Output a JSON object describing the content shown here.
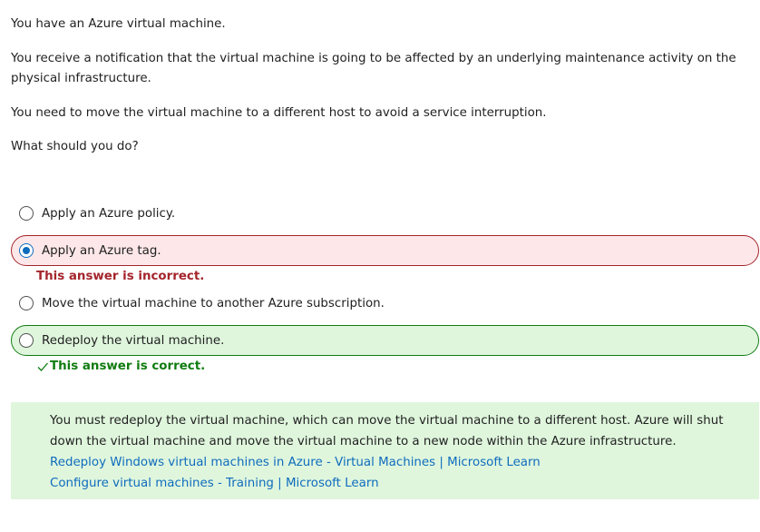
{
  "question": {
    "paragraphs": [
      "You have an Azure virtual machine.",
      "You receive a notification that the virtual machine is going to be affected by an underlying maintenance activity on the physical infrastructure.",
      "You need to move the virtual machine to a different host to avoid a service interruption.",
      "What should you do?"
    ]
  },
  "options": [
    {
      "label": "Apply an Azure policy.",
      "selected": false,
      "state": "neutral"
    },
    {
      "label": "Apply an Azure tag.",
      "selected": true,
      "state": "incorrect"
    },
    {
      "label": "Move the virtual machine to another Azure subscription.",
      "selected": false,
      "state": "neutral"
    },
    {
      "label": "Redeploy the virtual machine.",
      "selected": false,
      "state": "correct"
    }
  ],
  "feedback": {
    "incorrect": "This answer is incorrect.",
    "correct": "This answer is correct."
  },
  "explanation": {
    "text": "You must redeploy the virtual machine, which can move the virtual machine to a different host. Azure will shut down the virtual machine and move the virtual machine to a new node within the Azure infrastructure.",
    "links": [
      "Redeploy Windows virtual machines in Azure - Virtual Machines | Microsoft Learn",
      "Configure virtual machines - Training | Microsoft Learn"
    ]
  },
  "colors": {
    "incorrect_border": "#a4262c",
    "incorrect_bg": "#fde7e9",
    "correct_border": "#107c10",
    "correct_bg": "#dff6dd",
    "link": "#0f6cbd",
    "radio_checked": "#0f6cbd"
  },
  "icons": {
    "radio": "radio-button-icon",
    "check": "checkmark-icon"
  }
}
